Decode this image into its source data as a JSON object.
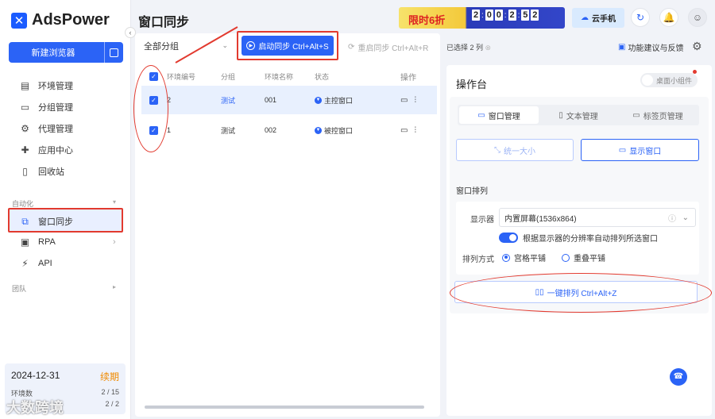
{
  "app": {
    "logo_text": "AdsPower",
    "page_title": "窗口同步"
  },
  "sidebar": {
    "new_browser": "新建浏览器",
    "items": [
      {
        "label": "环境管理",
        "icon": "folder-list-icon"
      },
      {
        "label": "分组管理",
        "icon": "folder-icon"
      },
      {
        "label": "代理管理",
        "icon": "proxy-icon"
      },
      {
        "label": "应用中心",
        "icon": "puzzle-icon"
      },
      {
        "label": "回收站",
        "icon": "trash-icon"
      }
    ],
    "section_automation": "自动化",
    "automation_items": [
      {
        "label": "窗口同步",
        "icon": "window-sync-icon"
      },
      {
        "label": "RPA",
        "icon": "rpa-icon"
      },
      {
        "label": "API",
        "icon": "api-icon"
      }
    ],
    "section_team": "团队",
    "plan": {
      "date": "2024-12-31",
      "renew": "续期",
      "env_label": "环境数",
      "env_value": "2 / 15",
      "member_value": "2 / 2"
    },
    "watermark": "大数跨境"
  },
  "topbar": {
    "promo": "限时6折",
    "countdown": [
      "2",
      "0",
      "0",
      "2",
      "5",
      "2"
    ],
    "cloud_phone": "云手机"
  },
  "toolbar": {
    "group_select": "全部分组",
    "start_sync": "启动同步 Ctrl+Alt+S",
    "restart_sync": "重启同步 Ctrl+Alt+R",
    "selected": "已选择 2 列",
    "feedback": "功能建议与反馈"
  },
  "table": {
    "headers": [
      "环境编号",
      "分组",
      "环境名称",
      "状态",
      "操作"
    ],
    "rows": [
      {
        "id": "2",
        "group": "测试",
        "name": "001",
        "status": "主控窗口"
      },
      {
        "id": "1",
        "group": "测试",
        "name": "002",
        "status": "被控窗口"
      }
    ]
  },
  "panel": {
    "title": "操作台",
    "widget_toggle": "桌面小组件",
    "tabs": [
      "窗口管理",
      "文本管理",
      "标签页管理"
    ],
    "unify_size": "统一大小",
    "show_window": "显示窗口",
    "arrange_title": "窗口排列",
    "monitor_label": "显示器",
    "monitor_value": "内置屏幕(1536x864)",
    "auto_arrange": "根据显示器的分辨率自动排列所选窗口",
    "arrange_mode_label": "排列方式",
    "mode_grid": "宫格平铺",
    "mode_overlap": "重叠平铺",
    "arrange_button": "一键排列 Ctrl+Alt+Z"
  },
  "colors": {
    "accent": "#2b63f6",
    "annotation": "#e23a2f"
  }
}
